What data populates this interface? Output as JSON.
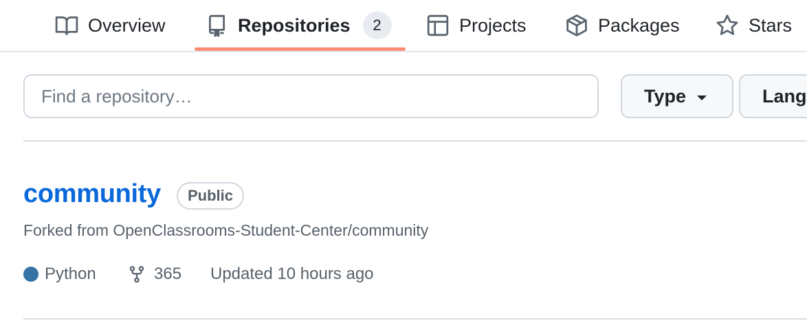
{
  "tabs": [
    {
      "label": "Overview",
      "icon": "book-icon",
      "selected": false
    },
    {
      "label": "Repositories",
      "icon": "repo-icon",
      "selected": true,
      "count": "2"
    },
    {
      "label": "Projects",
      "icon": "table-icon",
      "selected": false
    },
    {
      "label": "Packages",
      "icon": "package-icon",
      "selected": false
    },
    {
      "label": "Stars",
      "icon": "star-icon",
      "selected": false
    }
  ],
  "filters": {
    "search_placeholder": "Find a repository…",
    "type_label": "Type",
    "language_label": "Language"
  },
  "repos": [
    {
      "name": "community",
      "visibility": "Public",
      "forked_prefix": "Forked from ",
      "forked_from": "OpenClassrooms-Student-Center/community",
      "language": "Python",
      "forks": "365",
      "updated": "Updated 10 hours ago"
    }
  ],
  "colors": {
    "link": "#0969da",
    "tab_underline": "#fd8c73",
    "python": "#3572a5"
  }
}
